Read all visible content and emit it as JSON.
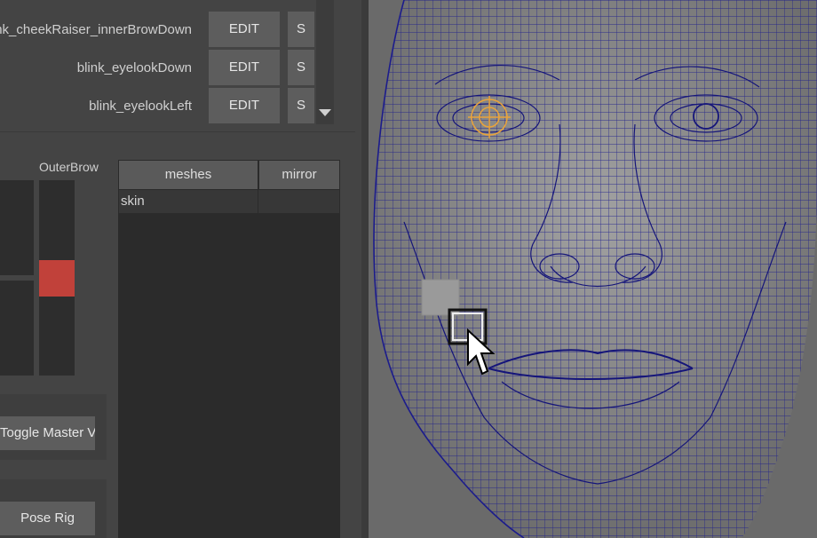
{
  "poses": [
    {
      "name": "blink_cheekRaiser_innerBrowDown",
      "edit_label": "EDIT",
      "s_label": "S"
    },
    {
      "name": "blink_eyelookDown",
      "edit_label": "EDIT",
      "s_label": "S"
    },
    {
      "name": "blink_eyelookLeft",
      "edit_label": "EDIT",
      "s_label": "S"
    }
  ],
  "slider_label": "OuterBrow",
  "slider_value": 0.5,
  "mesh_table": {
    "headers": [
      "meshes",
      "mirror"
    ],
    "rows": [
      {
        "mesh": "skin",
        "mirror": ""
      }
    ]
  },
  "buttons": {
    "toggle_master_vis": "Toggle Master Vis",
    "pose_rig": "Pose Rig"
  },
  "colors": {
    "slider_handle": "#c1413a",
    "wireframe": "#1c1c8c",
    "eye_locator": "#e8a33c"
  },
  "icons": [
    "chevron-down-icon",
    "eye-locator-icon",
    "cursor-arrow-icon"
  ]
}
